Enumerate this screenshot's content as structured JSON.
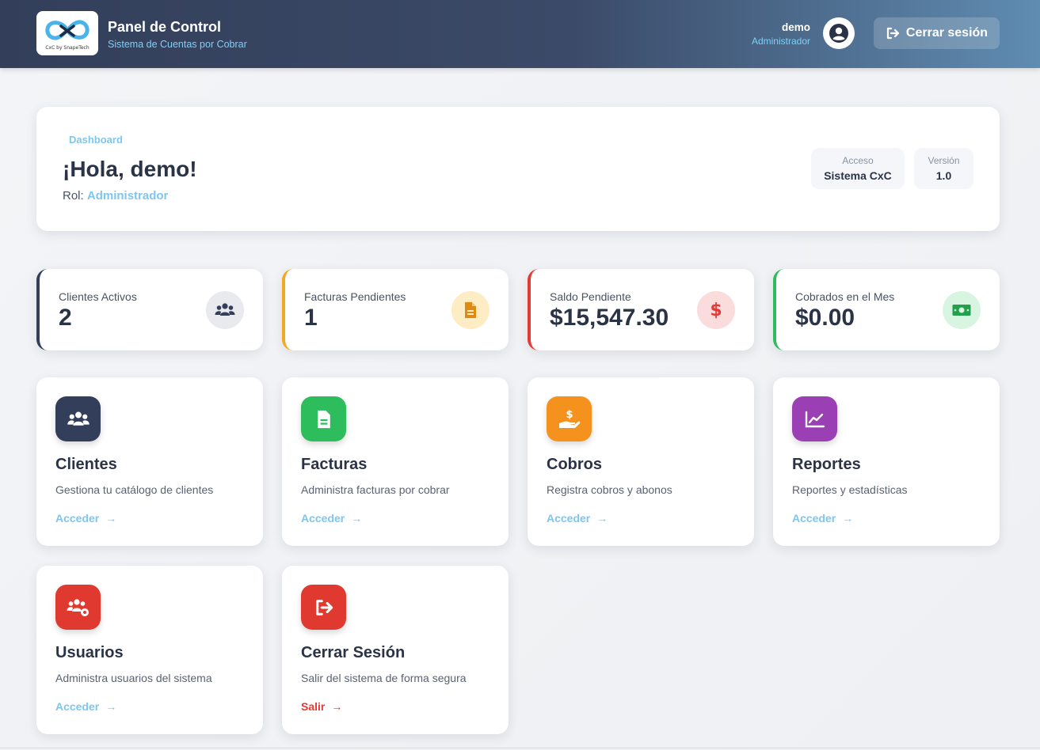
{
  "header": {
    "logo_text": "CxC by SnapeTech",
    "title": "Panel de Control",
    "subtitle": "Sistema de Cuentas por Cobrar",
    "user_name": "demo",
    "user_role": "Administrador",
    "logout_label": "Cerrar sesión"
  },
  "welcome": {
    "breadcrumb": "Dashboard",
    "greeting": "¡Hola, demo!",
    "role_label": "Rol:",
    "role_value": "Administrador",
    "pills": [
      {
        "label": "Acceso",
        "value": "Sistema CxC"
      },
      {
        "label": "Versión",
        "value": "1.0"
      }
    ]
  },
  "stats": [
    {
      "label": "Clientes Activos",
      "value": "2",
      "icon": "users-icon",
      "accent": "#333f5a",
      "icon_bg": "#e8eaee",
      "icon_color": "#333f5a"
    },
    {
      "label": "Facturas Pendientes",
      "value": "1",
      "icon": "invoice-icon",
      "accent": "#f5a623",
      "icon_bg": "#fdecc4",
      "icon_color": "#e08a12"
    },
    {
      "label": "Saldo Pendiente",
      "value": "$15,547.30",
      "icon": "dollar-icon",
      "accent": "#e53935",
      "icon_bg": "#fbdcdc",
      "icon_color": "#e53935"
    },
    {
      "label": "Cobrados en el Mes",
      "value": "$0.00",
      "icon": "money-bill-icon",
      "accent": "#2ebd5c",
      "icon_bg": "#d8f5e1",
      "icon_color": "#22a04c"
    }
  ],
  "modules": [
    {
      "title": "Clientes",
      "desc": "Gestiona tu catálogo de clientes",
      "link": "Acceder",
      "icon": "users-icon",
      "color": "#333f5a"
    },
    {
      "title": "Facturas",
      "desc": "Administra facturas por cobrar",
      "link": "Acceder",
      "icon": "invoice-icon",
      "color": "#2ebd5c"
    },
    {
      "title": "Cobros",
      "desc": "Registra cobros y abonos",
      "link": "Acceder",
      "icon": "hand-dollar-icon",
      "color": "#f5921e"
    },
    {
      "title": "Reportes",
      "desc": "Reportes y estadísticas",
      "link": "Acceder",
      "icon": "chart-line-icon",
      "color": "#9b3fb5"
    },
    {
      "title": "Usuarios",
      "desc": "Administra usuarios del sistema",
      "link": "Acceder",
      "icon": "users-gear-icon",
      "color": "#e03a30"
    },
    {
      "title": "Cerrar Sesión",
      "desc": "Salir del sistema de forma segura",
      "link": "Salir",
      "icon": "logout-icon",
      "color": "#e03a30"
    }
  ]
}
